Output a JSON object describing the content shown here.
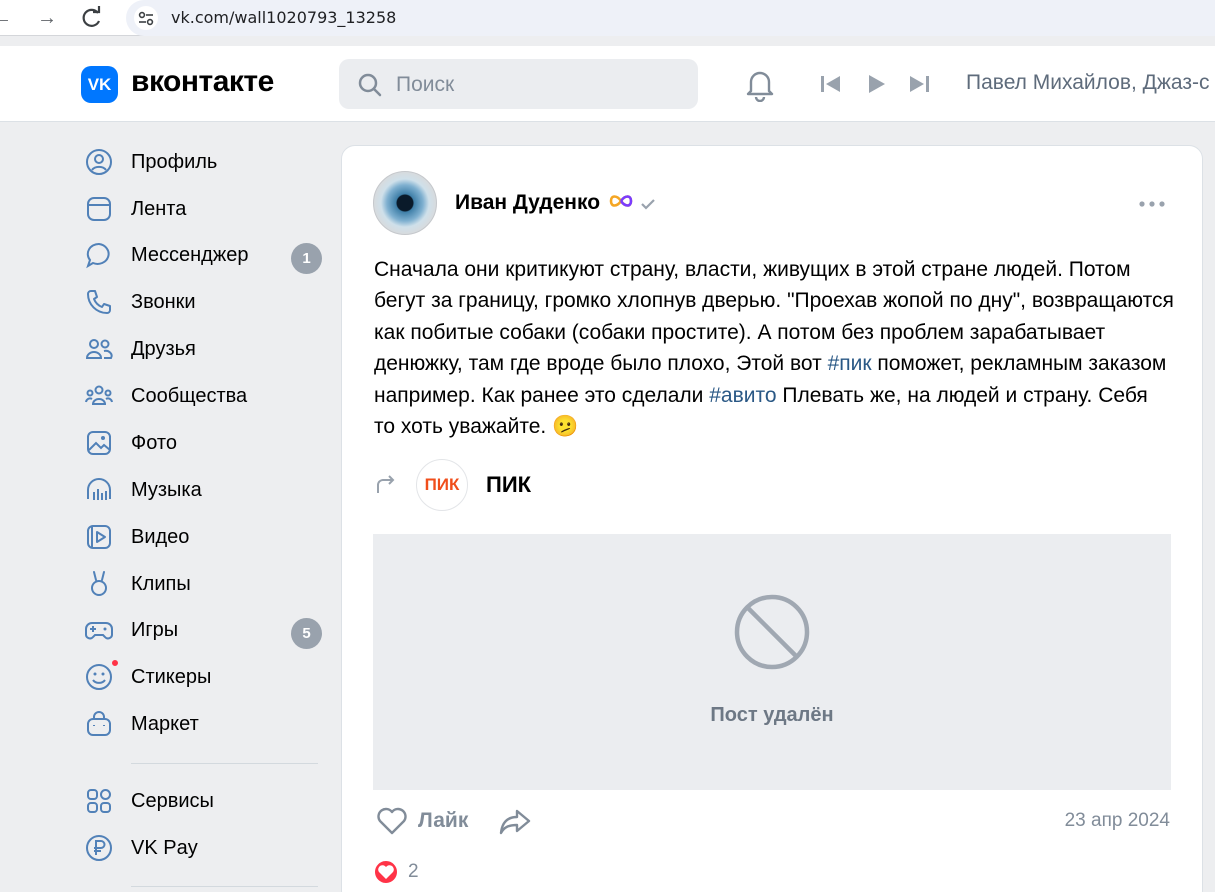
{
  "browser": {
    "url": "vk.com/wall1020793_13258"
  },
  "header": {
    "logo_text": "вконтакте",
    "logo_mark": "VK",
    "search_placeholder": "Поиск",
    "now_playing": "Павел Михайлов, Джаз-с"
  },
  "sidebar": {
    "items": [
      {
        "label": "Профиль",
        "icon": "user-circle-icon"
      },
      {
        "label": "Лента",
        "icon": "feed-icon"
      },
      {
        "label": "Мессенджер",
        "icon": "message-icon",
        "badge": "1"
      },
      {
        "label": "Звонки",
        "icon": "phone-icon"
      },
      {
        "label": "Друзья",
        "icon": "friends-icon"
      },
      {
        "label": "Сообщества",
        "icon": "communities-icon"
      },
      {
        "label": "Фото",
        "icon": "photo-icon"
      },
      {
        "label": "Музыка",
        "icon": "music-icon"
      },
      {
        "label": "Видео",
        "icon": "video-icon"
      },
      {
        "label": "Клипы",
        "icon": "clips-icon"
      },
      {
        "label": "Игры",
        "icon": "gamepad-icon",
        "badge": "5"
      },
      {
        "label": "Стикеры",
        "icon": "smile-icon"
      },
      {
        "label": "Маркет",
        "icon": "bag-icon"
      },
      {
        "label": "Сервисы",
        "icon": "services-icon"
      },
      {
        "label": "VK Pay",
        "icon": "ruble-icon"
      }
    ]
  },
  "post": {
    "author": "Иван Дуденко",
    "text_1": "Сначала они критикуют страну, власти, живущих в этой стране людей. Потом бегут за границу, громко хлопнув дверью. \"Проехав жопой по дну\", возвращаются как побитые собаки (собаки простите). А потом без проблем зарабатывает денюжку, там где вроде было плохо, Этой вот ",
    "hashtag_1": "#пик",
    "text_2": " поможет, рекламным заказом например. Как ранее это сделали ",
    "hashtag_2": "#авито",
    "text_3": " Плевать же, на людей и страну. Себя то хоть уважайте. 🫤",
    "repost_logo": "ПИК",
    "repost_name": "ПИК",
    "deleted_text": "Пост удалён",
    "like_label": "Лайк",
    "date": "23 апр 2024",
    "reaction_count": "2"
  },
  "colors": {
    "accent": "#0077ff",
    "link": "#2a5885",
    "badge": "#99a2ad",
    "like_red": "#ff3347",
    "pik_orange": "#f04e1b"
  }
}
